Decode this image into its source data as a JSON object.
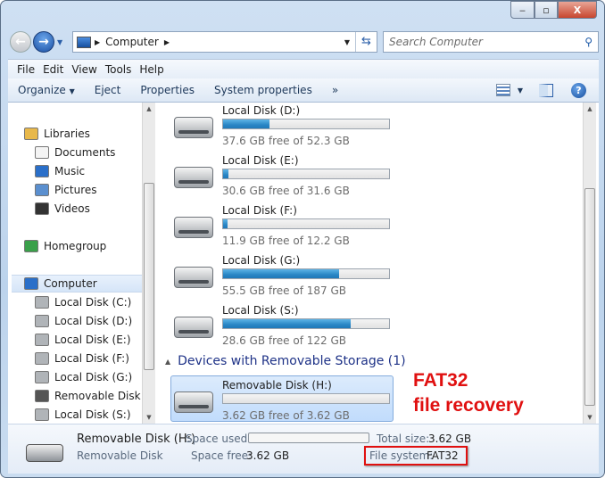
{
  "window": {
    "controls": {
      "minimize": "‒",
      "maximize": "▫",
      "close": "X"
    }
  },
  "address": {
    "path": [
      "Computer"
    ],
    "search_placeholder": "Search Computer"
  },
  "menu": [
    "File",
    "Edit",
    "View",
    "Tools",
    "Help"
  ],
  "toolbar": {
    "organize": "Organize",
    "eject": "Eject",
    "properties": "Properties",
    "system_properties": "System properties",
    "more": "»"
  },
  "sidebar": {
    "items": [
      {
        "label": "Libraries",
        "icon": "libraries-icon",
        "indent": 0
      },
      {
        "label": "Documents",
        "icon": "documents-icon",
        "indent": 1
      },
      {
        "label": "Music",
        "icon": "music-icon",
        "indent": 1
      },
      {
        "label": "Pictures",
        "icon": "pictures-icon",
        "indent": 1
      },
      {
        "label": "Videos",
        "icon": "videos-icon",
        "indent": 1
      },
      {
        "label": "Homegroup",
        "icon": "homegroup-icon",
        "indent": 0,
        "gap": true
      },
      {
        "label": "Computer",
        "icon": "computer-icon",
        "indent": 0,
        "gap": true,
        "selected": true
      },
      {
        "label": "Local Disk (C:)",
        "icon": "system-drive-icon",
        "indent": 1
      },
      {
        "label": "Local Disk (D:)",
        "icon": "drive-icon",
        "indent": 1
      },
      {
        "label": "Local Disk (E:)",
        "icon": "drive-icon",
        "indent": 1
      },
      {
        "label": "Local Disk (F:)",
        "icon": "drive-icon",
        "indent": 1
      },
      {
        "label": "Local Disk (G:)",
        "icon": "drive-icon",
        "indent": 1
      },
      {
        "label": "Removable Disk (H:)",
        "icon": "removable-drive-icon",
        "indent": 1
      },
      {
        "label": "Local Disk (S:)",
        "icon": "drive-icon",
        "indent": 1
      }
    ]
  },
  "drives": [
    {
      "name": "Local Disk (D:)",
      "free": "37.6 GB free of 52.3 GB",
      "used_fraction": 0.28
    },
    {
      "name": "Local Disk (E:)",
      "free": "30.6 GB free of 31.6 GB",
      "used_fraction": 0.03
    },
    {
      "name": "Local Disk (F:)",
      "free": "11.9 GB free of 12.2 GB",
      "used_fraction": 0.025
    },
    {
      "name": "Local Disk (G:)",
      "free": "55.5 GB free of 187 GB",
      "used_fraction": 0.7
    },
    {
      "name": "Local Disk (S:)",
      "free": "28.6 GB free of 122 GB",
      "used_fraction": 0.77
    }
  ],
  "removable_group": {
    "title": "Devices with Removable Storage (1)"
  },
  "removable": {
    "name": "Removable Disk (H:)",
    "free": "3.62 GB free of 3.62 GB",
    "used_fraction": 0.0
  },
  "annotation": {
    "line1": "FAT32",
    "line2": "file recovery",
    "color": "#e01010"
  },
  "details": {
    "name": "Removable Disk (H:)",
    "type": "Removable Disk",
    "space_used_label": "Space used:",
    "space_free_label": "Space free:",
    "space_free": "3.62 GB",
    "total_size_label": "Total size:",
    "total_size": "3.62 GB",
    "fs_label": "File system:",
    "fs": "FAT32"
  }
}
